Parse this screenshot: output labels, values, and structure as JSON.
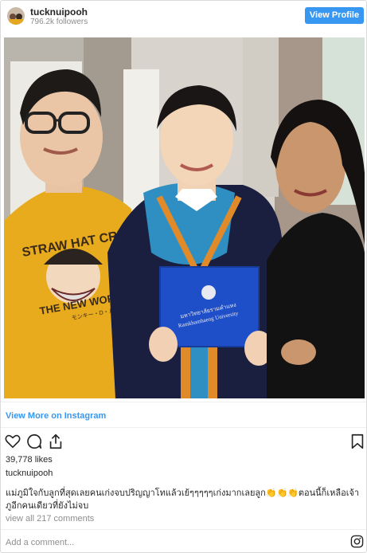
{
  "header": {
    "username": "tucknuipooh",
    "followers": "796.2k followers",
    "view_profile_label": "View Profile",
    "avatar_icon": "profile-avatar"
  },
  "post": {
    "photo_desc_icon": "post-photo",
    "diploma_text_line1": "มหาวิทยาลัยรามคำแหง",
    "diploma_text_line2": "Ramkhamhaeng University",
    "shirt_line1": "STRAW HAT CREW",
    "shirt_line2": "THE NEW WORLD",
    "shirt_line3": "モンキー・D・ルフィ"
  },
  "view_more_label": "View More on Instagram",
  "actions": {
    "like_icon": "heart-icon",
    "comment_icon": "comment-icon",
    "share_icon": "share-icon",
    "save_icon": "bookmark-icon"
  },
  "likes": "39,778 likes",
  "caption": {
    "username": "tucknuipooh",
    "text": "แม่ภูมิใจกับลูกที่สุดเลยคนเก่งจบปริญญาโทแล้วเย้ๆๆๆๆๆเก่งมากเลยลูก👏👏👏ตอนนี้ก็เหลือเจ้าภูอีกคนเดียวที่ยังไม่จบ"
  },
  "view_comments": "view all 217 comments",
  "comment_placeholder": "Add a comment...",
  "instagram_icon": "instagram-icon",
  "colors": {
    "accent": "#3897f0",
    "muted": "#8e8e8e",
    "text": "#262626"
  }
}
